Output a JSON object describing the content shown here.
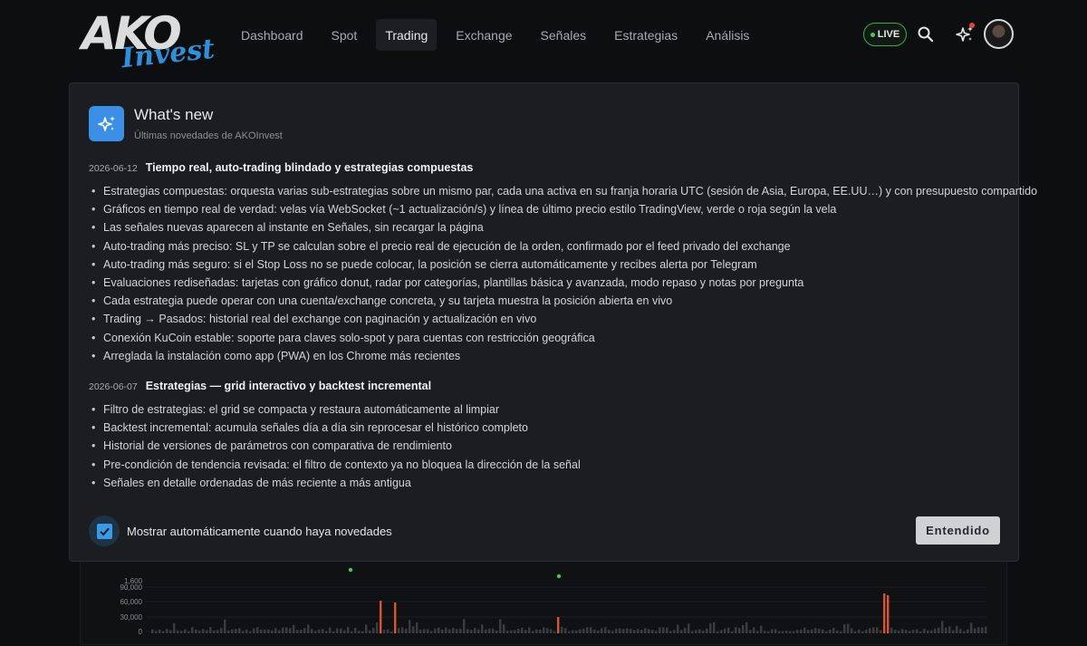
{
  "brand": {
    "logo_main": "AKO",
    "logo_script": "Invest"
  },
  "nav": {
    "items": [
      {
        "label": "Dashboard",
        "active": false
      },
      {
        "label": "Spot",
        "active": false
      },
      {
        "label": "Trading",
        "active": true
      },
      {
        "label": "Exchange",
        "active": false
      },
      {
        "label": "Señales",
        "active": false
      },
      {
        "label": "Estrategias",
        "active": false
      },
      {
        "label": "Análisis",
        "active": false
      }
    ],
    "live_label": "LIVE",
    "icons": [
      "search-icon",
      "sparkles-icon",
      "avatar"
    ]
  },
  "modal": {
    "title": "What's new",
    "subtitle": "Últimas novedades de AKOInvest",
    "icon": "sparkles-icon",
    "releases": [
      {
        "date": "2026-06-12",
        "title": "Tiempo real, auto-trading blindado y estrategias compuestas",
        "items": [
          "Estrategias compuestas: orquesta varias sub-estrategias sobre un mismo par, cada una activa en su franja horaria UTC (sesión de Asia, Europa, EE.UU…) y con presupuesto compartido",
          "Gráficos en tiempo real de verdad: velas vía WebSocket (~1 actualización/s) y línea de último precio estilo TradingView, verde o roja según la vela",
          "Las señales nuevas aparecen al instante en Señales, sin recargar la página",
          "Auto-trading más preciso: SL y TP se calculan sobre el precio real de ejecución de la orden, confirmado por el feed privado del exchange",
          "Auto-trading más seguro: si el Stop Loss no se puede colocar, la posición se cierra automáticamente y recibes alerta por Telegram",
          "Evaluaciones rediseñadas: tarjetas con gráfico donut, radar por categorías, plantillas básica y avanzada, modo repaso y notas por pregunta",
          "Cada estrategia puede operar con una cuenta/exchange concreta, y su tarjeta muestra la posición abierta en vivo",
          "Trading → Pasados: historial real del exchange con paginación y actualización en vivo",
          "Conexión KuCoin estable: soporte para claves solo-spot y para cuentas con restricción geográfica",
          "Arreglada la instalación como app (PWA) en los Chrome más recientes"
        ]
      },
      {
        "date": "2026-06-07",
        "title": "Estrategias — grid interactivo y backtest incremental",
        "items": [
          "Filtro de estrategias: el grid se compacta y restaura automáticamente al limpiar",
          "Backtest incremental: acumula señales día a día sin reprocesar el histórico completo",
          "Historial de versiones de parámetros con comparativa de rendimiento",
          "Pre-condición de tendencia revisada: el filtro de contexto ya no bloquea la dirección de la señal",
          "Señales en detalle ordenadas de más reciente a más antigua"
        ]
      }
    ],
    "checkbox_label": "Mostrar automáticamente cuando haya novedades",
    "checkbox_checked": true,
    "confirm_label": "Entendido"
  },
  "background_chart": {
    "price_tick": "1,600",
    "volume_ticks": [
      "90,000",
      "60,000",
      "30,000",
      "0"
    ]
  },
  "colors": {
    "accent_blue": "#3b8fe6",
    "live_green": "#2fae4b",
    "bar_red": "#d9542f",
    "bar_gray": "#3a3c40"
  }
}
